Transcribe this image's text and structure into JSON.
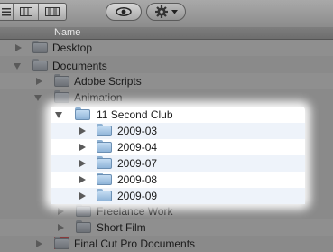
{
  "toolbar": {
    "view_icons": [
      "list-view-icon",
      "column-view-icon",
      "coverflow-view-icon"
    ],
    "quicklook_icon": "eye-icon",
    "action_icon": "gear-icon",
    "action_menu_icon": "chevron-down-icon"
  },
  "header": {
    "name_column": "Name"
  },
  "items": {
    "desktop": "Desktop",
    "documents": "Documents",
    "adobe_scripts": "Adobe Scripts",
    "animation": "Animation",
    "club": "11 Second Club",
    "m1": "2009-03",
    "m2": "2009-04",
    "m3": "2009-07",
    "m4": "2009-08",
    "m5": "2009-09",
    "freelance": "Freelance Work",
    "short_film": "Short Film",
    "final_cut": "Final Cut Pro Documents"
  },
  "colors": {
    "highlight": "#ffffff",
    "folder_blue": "#a9c9e8",
    "folder_grey": "#7c8086"
  }
}
